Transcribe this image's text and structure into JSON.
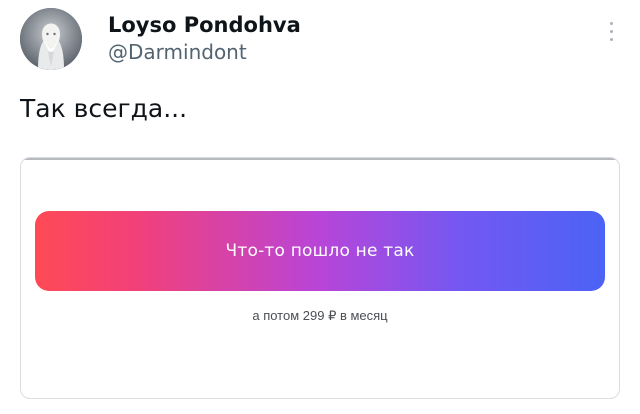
{
  "tweet": {
    "author": {
      "display_name": "Loyso Pondohva",
      "handle": "@Darmindont",
      "avatar": "profile-avatar"
    },
    "more_icon": "more-vertical-icon",
    "text": "Так всегда...",
    "media": {
      "button_label": "Что-то пошло не так",
      "caption": "а потом 299 ₽ в месяц",
      "gradient_colors": [
        "#ff4a55",
        "#b845d8",
        "#4b63f5"
      ]
    }
  }
}
